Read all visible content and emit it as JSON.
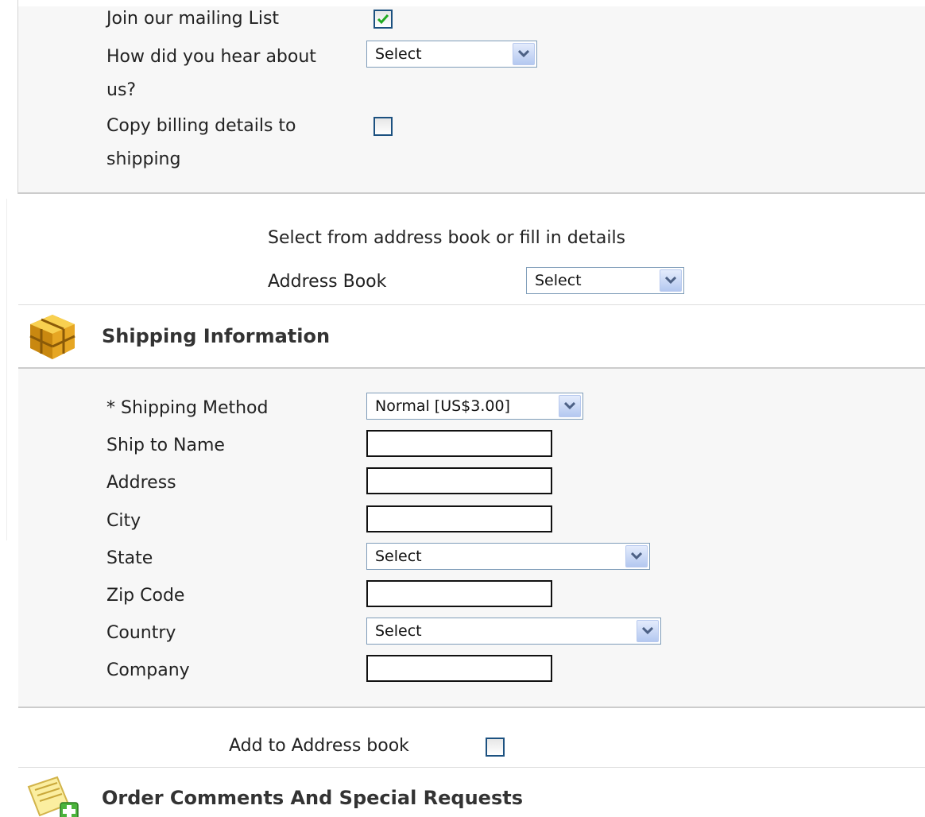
{
  "billing": {
    "mailing_list_label": "Join our mailing List",
    "mailing_list_checked": true,
    "hear_about_label_1": "How did you hear about",
    "hear_about_label_2": "us?",
    "hear_about_value": "Select",
    "copy_billing_label_1": "Copy billing details to",
    "copy_billing_label_2": "shipping",
    "copy_billing_checked": false
  },
  "address_book": {
    "hint": "Select from address book or fill in details",
    "label": "Address Book",
    "value": "Select"
  },
  "shipping": {
    "title": "Shipping Information",
    "icon": "package-box-icon",
    "method_label": "* Shipping Method",
    "method_value": "Normal [US$3.00]",
    "name_label": "Ship to Name",
    "name_value": "",
    "address_label": "Address",
    "address_value": "",
    "city_label": "City",
    "city_value": "",
    "state_label": "State",
    "state_value": "Select",
    "zip_label": "Zip Code",
    "zip_value": "",
    "country_label": "Country",
    "country_value": "Select",
    "company_label": "Company",
    "company_value": ""
  },
  "add_to_book": {
    "label": "Add to Address book",
    "checked": false
  },
  "comments": {
    "title": "Order Comments And Special Requests",
    "icon": "note-add-icon"
  },
  "colors": {
    "panel_bg": "#f7f7f7",
    "border": "#cccccc",
    "checkbox_border": "#1c5180",
    "check_mark": "#22aa22",
    "select_border": "#7f9db9"
  }
}
